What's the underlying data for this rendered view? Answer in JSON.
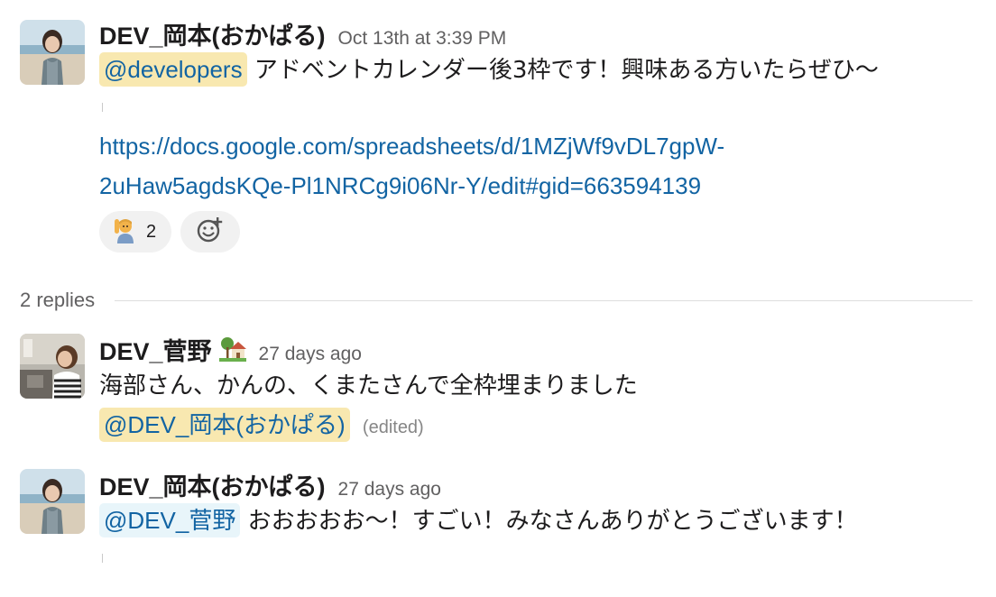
{
  "messages": [
    {
      "sender": "DEV_岡本(おかぱる)",
      "timestamp": "Oct 13th at 3:39 PM",
      "mention": "@developers",
      "text": "アドベントカレンダー後3枠です！興味ある方いたらぜひ〜",
      "link_line1": "https://docs.google.com/spreadsheets/d/1MZjWf9vDL7gpW-",
      "link_line2": "2uHaw5agdsKQe-Pl1NRCg9i06Nr-Y/edit#gid=663594139",
      "reaction": {
        "icon": "raising-hand-icon",
        "count": "2"
      },
      "add_reaction_icon": "add-emoji-icon"
    },
    {
      "sender": "DEV_菅野",
      "status_icon": "house-with-garden-icon",
      "timestamp": "27 days ago",
      "text": "海部さん、かんの、くまたさんで全枠埋まりました",
      "mention": "@DEV_岡本(おかぱる)",
      "edited": "(edited)"
    },
    {
      "sender": "DEV_岡本(おかぱる)",
      "timestamp": "27 days ago",
      "mention": "@DEV_菅野",
      "text": "おおおおお〜！すごい！みなさんありがとうございます！"
    }
  ],
  "replies": {
    "label": "2 replies"
  },
  "colors": {
    "link": "#1264a3",
    "mention_bg": "#f8e8b0",
    "mention_self_bg": "#e8f5fa",
    "timestamp": "#616061"
  }
}
